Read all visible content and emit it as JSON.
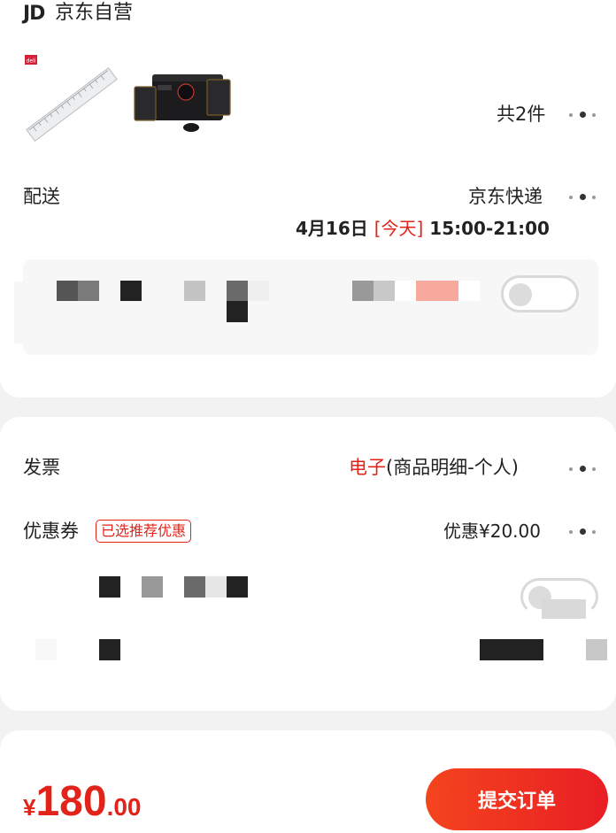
{
  "shop": {
    "logo_text": "JD",
    "name": "京东自营"
  },
  "products": {
    "count_label": "共2件",
    "items": [
      {
        "icon": "ruler-icon",
        "badge": "deli"
      },
      {
        "icon": "speaker-icon"
      }
    ]
  },
  "delivery": {
    "label": "配送",
    "method": "京东快递",
    "date": "4月16日",
    "day_tag": "[今天]",
    "time_range": "15:00-21:00"
  },
  "invoice": {
    "label": "发票",
    "type_highlight": "电子",
    "type_detail": "(商品明细-个人)"
  },
  "coupon": {
    "label": "优惠券",
    "badge": "已选推荐优惠",
    "discount": "优惠¥20.00"
  },
  "footer": {
    "currency": "¥",
    "price_int": "180",
    "price_dec": ".00",
    "submit_label": "提交订单"
  },
  "colors": {
    "accent": "#e2231a",
    "submit_gradient_start": "#f4441d",
    "submit_gradient_end": "#e81e25",
    "background": "#f2f2f2"
  }
}
